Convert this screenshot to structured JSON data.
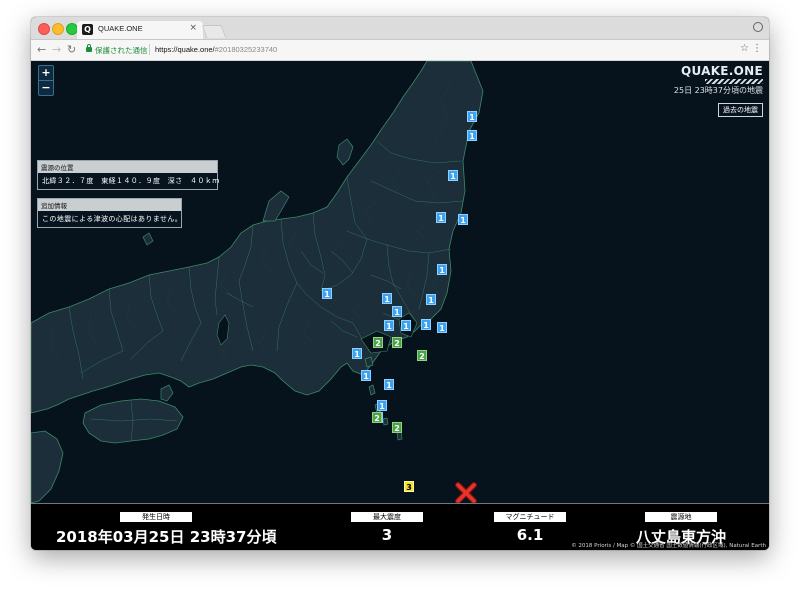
{
  "browser": {
    "tab_title": "QUAKE.ONE",
    "favicon": "Q",
    "tab_close": "×",
    "secure_label": "保護された通信",
    "url_host": "https://quake.one/",
    "url_hash": "#20180325233740"
  },
  "map": {
    "zoom_in": "+",
    "zoom_out": "−",
    "brand": "QUAKE.ONE",
    "brand_sub": "25日 23時37分頃の地震",
    "past_button": "過去の地震",
    "epicenter_panel": {
      "title": "震源の位置",
      "text": "北緯３２．７度　東経１４０．９度　深さ　４０ｋｍ"
    },
    "extra_panel": {
      "title": "追加情報",
      "text": "この地震による津波の心配はありません。"
    },
    "epicenter_marker": "x-icon",
    "intensity_colors": {
      "1": "#3da3f0",
      "2": "#49a24b",
      "3": "#f2e231"
    }
  },
  "intensities": [
    "1",
    "1",
    "1",
    "1",
    "1",
    "1",
    "1",
    "1",
    "1",
    "1",
    "1",
    "1",
    "1",
    "1",
    "2",
    "2",
    "1",
    "2",
    "1",
    "1",
    "1",
    "1",
    "2",
    "2",
    "3"
  ],
  "info": {
    "date_label": "発生日時",
    "date_value": "2018年03月25日 23時37分頃",
    "max_label": "最大震度",
    "max_value": "3",
    "mag_label": "マグニチュード",
    "mag_value": "6.1",
    "place_label": "震源地",
    "place_value": "八丈島東方沖"
  },
  "copyright": "© 2018 Prioris / Map © 国土交通省 国土数値情報(行政区域), Natural Earth"
}
